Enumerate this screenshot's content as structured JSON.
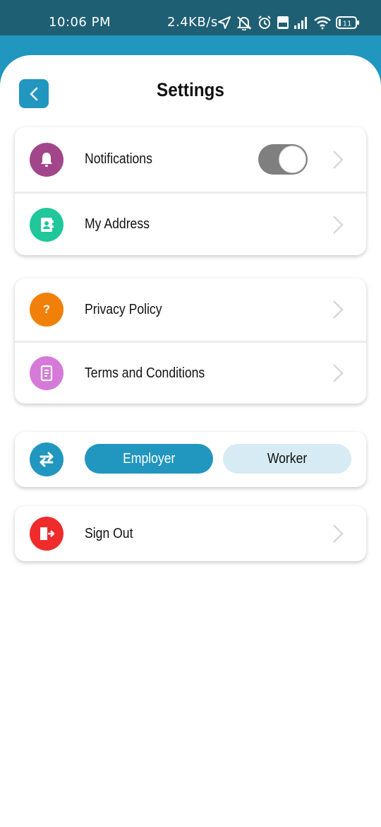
{
  "status_bar": {
    "time": "10:06 PM",
    "net_speed": "2.4KB/s",
    "icons": [
      "location-arrow-icon",
      "muted-bell-icon",
      "alarm-icon",
      "volte-icon",
      "signal-icon",
      "wifi-icon",
      "battery-icon"
    ],
    "battery_level": "11"
  },
  "header": {
    "title": "Settings",
    "back_icon": "chevron-left-icon"
  },
  "sections": {
    "notifications": {
      "label": "Notifications",
      "icon": "bell-icon",
      "icon_color": "#a2468b",
      "toggle_on": true
    },
    "my_address": {
      "label": "My Address",
      "icon": "contact-book-icon",
      "icon_color": "#1fc79a"
    },
    "privacy_policy": {
      "label": "Privacy Policy",
      "icon": "question-icon",
      "icon_glyph": "?",
      "icon_color": "#f08007"
    },
    "terms": {
      "label": "Terms and Conditions",
      "icon": "document-icon",
      "icon_color": "#d57ad9"
    },
    "role": {
      "icon": "swap-arrows-icon",
      "icon_color": "#2196bf",
      "options": [
        "Employer",
        "Worker"
      ],
      "selected": "Employer"
    },
    "sign_out": {
      "label": "Sign Out",
      "icon": "exit-door-icon",
      "icon_color": "#ef2b2b"
    }
  },
  "colors": {
    "status_bar": "#1f5f74",
    "accent": "#2196bf",
    "accent_light": "#d6ebf3",
    "toggle_track": "#7f7f7f"
  }
}
